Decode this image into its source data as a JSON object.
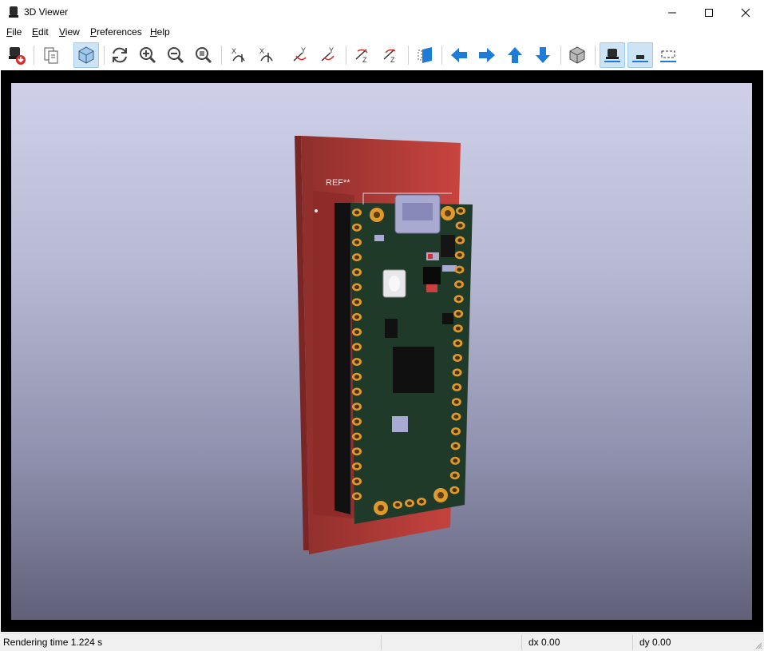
{
  "window": {
    "title": "3D Viewer"
  },
  "menu": [
    "File",
    "Edit",
    "View",
    "Preferences",
    "Help"
  ],
  "toolbar": {
    "buttons": [
      "reload-board-icon",
      "copy-image-icon",
      "render-mode-icon",
      "redraw-icon",
      "zoom-in-icon",
      "zoom-out-icon",
      "zoom-fit-icon",
      "rotate-x-cw-icon",
      "rotate-x-ccw-icon",
      "rotate-y-cw-icon",
      "rotate-y-ccw-icon",
      "rotate-z-cw-icon",
      "rotate-z-ccw-icon",
      "flip-board-icon",
      "move-left-icon",
      "move-right-icon",
      "move-up-icon",
      "move-down-icon",
      "ortho-icon",
      "layers-top-icon",
      "layers-bottom-icon",
      "layers-frame-icon"
    ]
  },
  "scene": {
    "ref_label": "REF**"
  },
  "status": {
    "render_time": "Rendering time 1.224 s",
    "dx": "dx 0.00",
    "dy": "dy 0.00"
  },
  "colors": {
    "accent_blue": "#1f7bd8",
    "pcb_red": "#c9443f",
    "board_green": "#1f3a28",
    "pad_gold": "#e0992b"
  }
}
